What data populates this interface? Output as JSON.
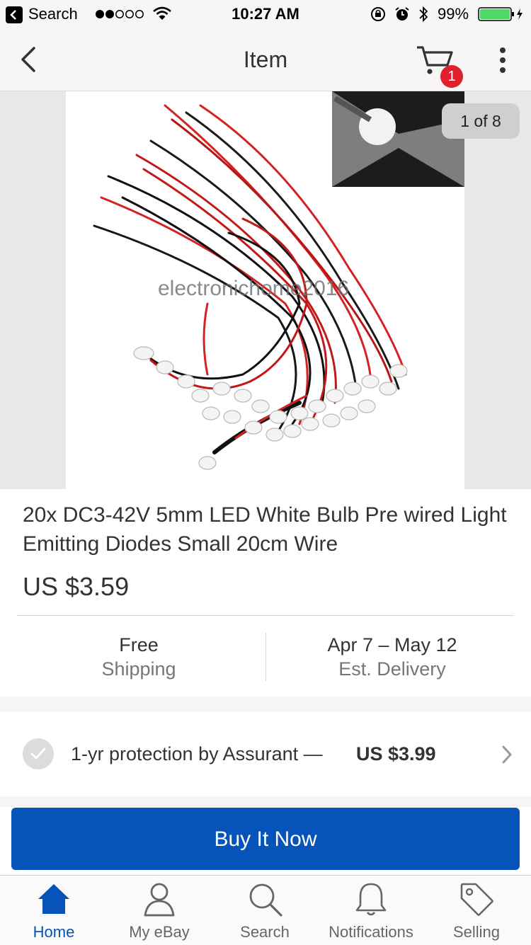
{
  "status_bar": {
    "back_app": "Search",
    "time": "10:27 AM",
    "battery": "99%"
  },
  "nav": {
    "title": "Item",
    "cart_count": "1"
  },
  "image": {
    "counter": "1 of 8",
    "watermark": "electronichome2016"
  },
  "item": {
    "title": "20x DC3-42V 5mm LED White Bulb Pre wired Light Emitting Diodes Small 20cm Wire",
    "price": "US $3.59"
  },
  "shipping": {
    "main": "Free",
    "sub": "Shipping"
  },
  "delivery": {
    "main": "Apr 7 – May 12",
    "sub": "Est. Delivery"
  },
  "protection": {
    "label": "1-yr protection by Assurant —",
    "price": "US $3.99"
  },
  "buy_now_label": "Buy It Now",
  "tabs": [
    {
      "label": "Home",
      "icon": "home-icon"
    },
    {
      "label": "My eBay",
      "icon": "person-icon"
    },
    {
      "label": "Search",
      "icon": "search-icon"
    },
    {
      "label": "Notifications",
      "icon": "bell-icon"
    },
    {
      "label": "Selling",
      "icon": "tag-icon"
    }
  ],
  "colors": {
    "accent": "#0654ba",
    "badge": "#e0202f",
    "battery": "#4cd964"
  }
}
